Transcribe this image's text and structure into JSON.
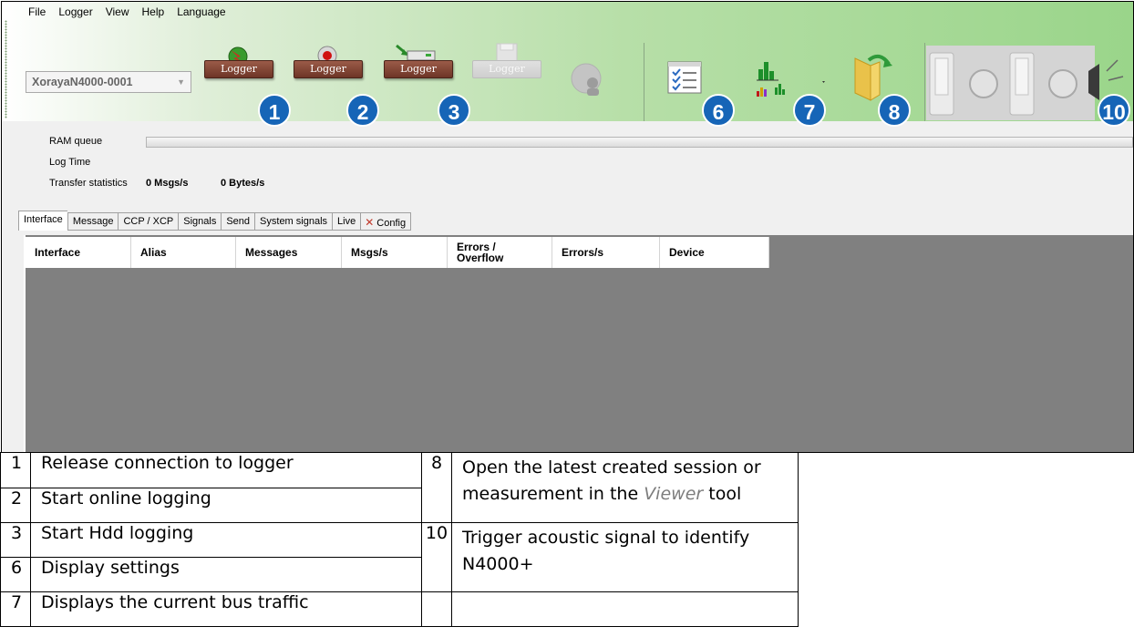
{
  "menu": [
    "File",
    "Logger",
    "View",
    "Help",
    "Language"
  ],
  "device": {
    "selected": "XorayaN4000-0001"
  },
  "toolbar": {
    "logger_label": "Logger",
    "badges": [
      "1",
      "2",
      "3",
      "6",
      "7",
      "8",
      "10"
    ]
  },
  "status": {
    "ram_queue_label": "RAM queue",
    "log_time_label": "Log Time",
    "transfer_label": "Transfer statistics",
    "msgs_rate": "0 Msgs/s",
    "bytes_rate": "0 Bytes/s"
  },
  "tabs": [
    "Interface",
    "Message",
    "CCP / XCP",
    "Signals",
    "Send",
    "System signals",
    "Live",
    "Config"
  ],
  "grid": {
    "columns": [
      "Interface",
      "Alias",
      "Messages",
      "Msgs/s",
      "Errors /\nOverflow",
      "Errors/s",
      "Device"
    ]
  },
  "legend": {
    "rows": [
      {
        "n": "1",
        "text": "Release connection to logger"
      },
      {
        "n": "2",
        "text": "Start online logging"
      },
      {
        "n": "3",
        "text": "Start Hdd logging"
      },
      {
        "n": "6",
        "text": "Display settings"
      },
      {
        "n": "7",
        "text": "Displays the current bus traffic"
      }
    ],
    "right": [
      {
        "n": "8",
        "text_before": "Open the latest created session or measurement in the ",
        "emph": "Viewer",
        "text_after": " tool"
      },
      {
        "n": "10",
        "text": "Trigger acoustic signal to identify N4000+"
      }
    ]
  },
  "colors": {
    "badge": "#1665b7",
    "grid_bg": "#808080",
    "toolbar_accent": "#9ad58a"
  }
}
